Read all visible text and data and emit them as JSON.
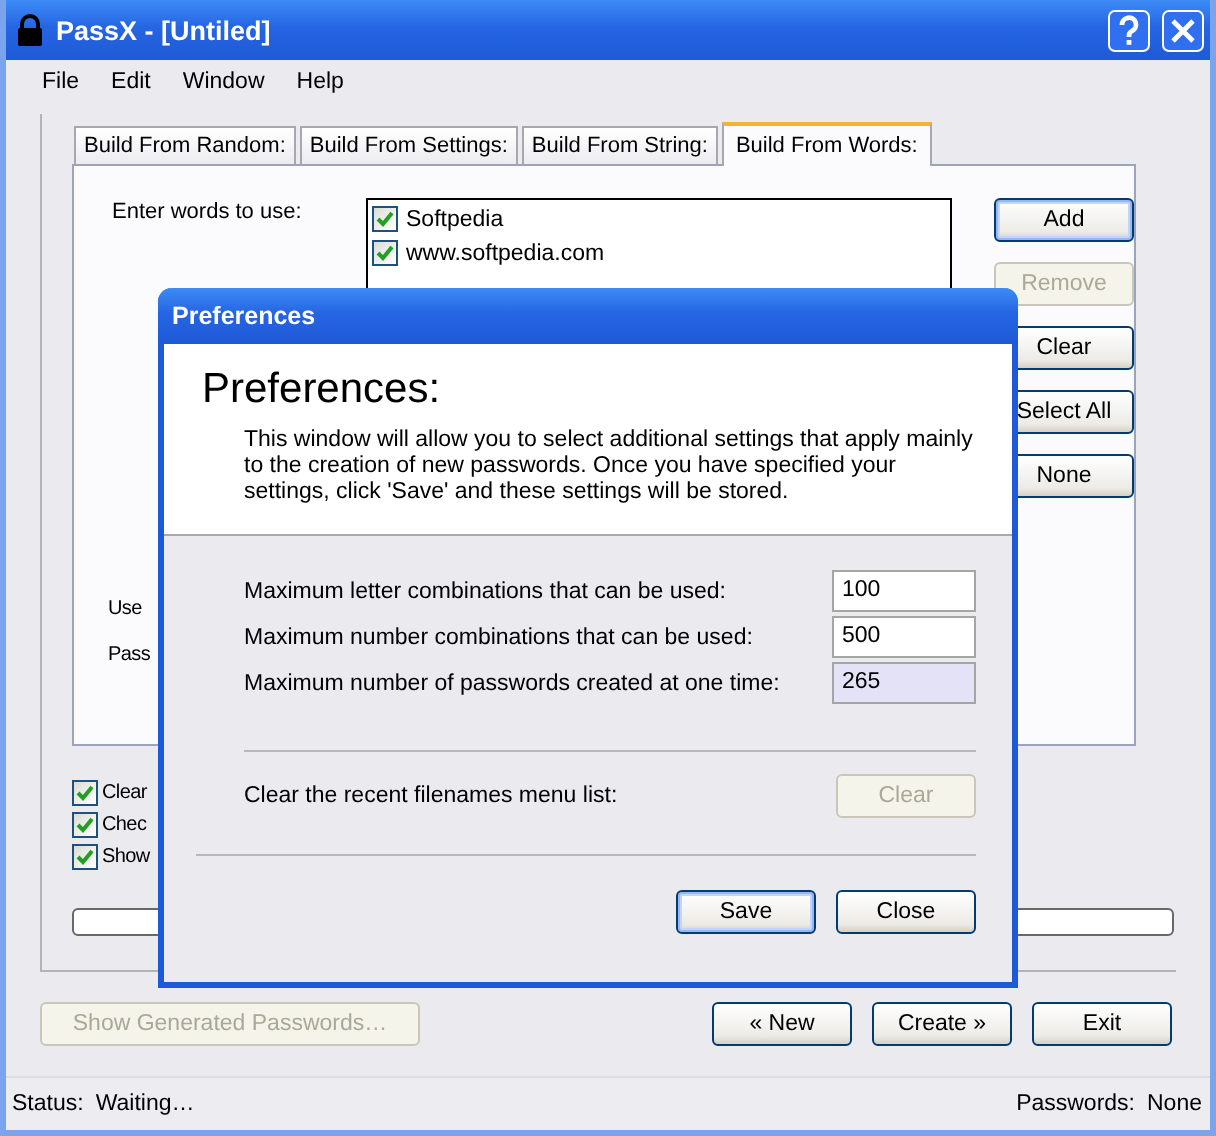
{
  "window": {
    "title": "PassX - [Untiled]"
  },
  "menu": [
    "File",
    "Edit",
    "Window",
    "Help"
  ],
  "tabs": [
    {
      "label": "Build From Random:",
      "selected": false
    },
    {
      "label": "Build From Settings:",
      "selected": false
    },
    {
      "label": "Build From String:",
      "selected": false
    },
    {
      "label": "Build From Words:",
      "selected": true
    }
  ],
  "words_panel": {
    "label": "Enter words to use:",
    "words": [
      {
        "text": "Softpedia",
        "checked": true
      },
      {
        "text": "www.softpedia.com",
        "checked": true
      }
    ],
    "buttons": [
      {
        "label": "Add",
        "disabled": false,
        "default": true
      },
      {
        "label": "Remove",
        "disabled": true,
        "default": false
      },
      {
        "label": "Clear",
        "disabled": false,
        "default": false
      },
      {
        "label": "Select All",
        "disabled": false,
        "default": false
      },
      {
        "label": "None",
        "disabled": false,
        "default": false
      }
    ],
    "partial_labels": [
      "Use",
      "Pass"
    ]
  },
  "options": [
    {
      "label": "Clear",
      "checked": true
    },
    {
      "label": "Chec",
      "checked": true
    },
    {
      "label": "Show",
      "checked": true
    }
  ],
  "progress": {
    "level": 0
  },
  "actions": [
    {
      "label": "Show Generated Passwords…",
      "disabled": true
    },
    {
      "label": "« New",
      "disabled": false
    },
    {
      "label": "Create »",
      "disabled": false
    },
    {
      "label": "Exit",
      "disabled": false
    }
  ],
  "status_bar": {
    "status_label": "Status:",
    "status": "Waiting…",
    "passwords_label": "Passwords:",
    "passwords": "None"
  },
  "dialog": {
    "title": "Preferences",
    "heading": "Preferences:",
    "description": "This window will allow you to select additional settings that apply mainly to the creation of new passwords.  Once you have specified your settings, click 'Save' and these settings will be stored.",
    "settings": [
      {
        "label": "Maximum letter combinations that can be used:",
        "value": "100",
        "focused": false
      },
      {
        "label": "Maximum number combinations that can be used:",
        "value": "500",
        "focused": false
      },
      {
        "label": "Maximum number of passwords created at one time:",
        "value": "265",
        "focused": true
      }
    ],
    "clear_label": "Clear the recent filenames menu list:",
    "clear_button": {
      "label": "Clear",
      "disabled": true
    },
    "buttons": [
      {
        "label": "Save",
        "default": true
      },
      {
        "label": "Close",
        "default": false
      }
    ]
  }
}
